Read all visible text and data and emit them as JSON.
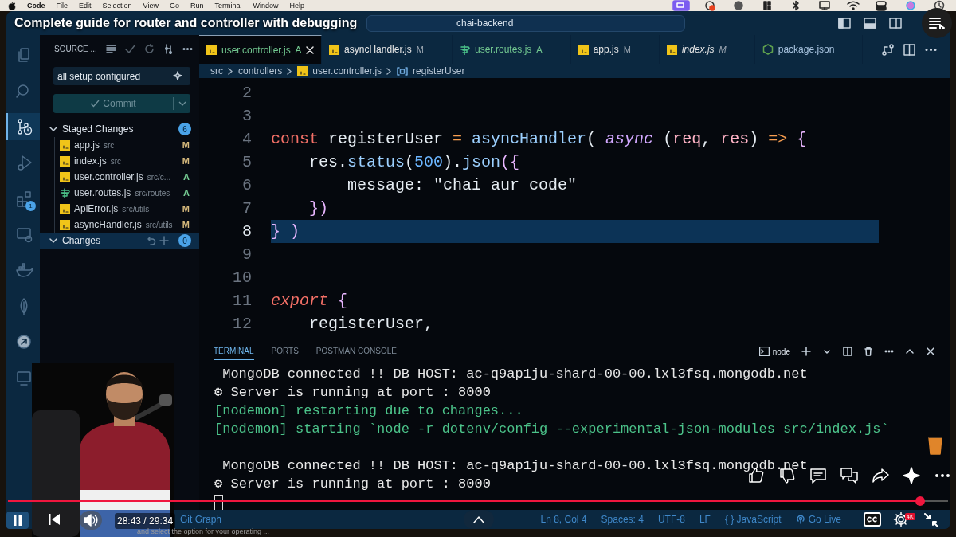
{
  "menubar": {
    "items": [
      "Code",
      "File",
      "Edit",
      "Selection",
      "View",
      "Go",
      "Run",
      "Terminal",
      "Window",
      "Help"
    ]
  },
  "video": {
    "title": "Complete guide for router and controller with debugging",
    "time": "28:43 / 29:34",
    "level": 0.97,
    "playing": true,
    "quality_badge": "4K"
  },
  "window": {
    "search": "chai-backend"
  },
  "activity_bar": {
    "items": [
      {
        "kind": "files",
        "selected": false
      },
      {
        "kind": "search",
        "selected": false
      },
      {
        "kind": "scm",
        "selected": true
      },
      {
        "kind": "debug",
        "selected": false
      },
      {
        "kind": "extensions",
        "selected": false,
        "badge": "1"
      },
      {
        "kind": "remote",
        "selected": false
      },
      {
        "kind": "docker",
        "selected": false
      },
      {
        "kind": "leaf",
        "selected": false
      },
      {
        "kind": "share",
        "selected": false
      },
      {
        "kind": "screen",
        "selected": false
      }
    ]
  },
  "sidebar": {
    "title": "SOURCE ...",
    "commit_message": "all setup configured",
    "commit_button": "Commit",
    "staged": {
      "label": "Staged Changes",
      "count": "6",
      "expanded": true,
      "files": [
        {
          "name": "app.js",
          "path": "src",
          "status": "M",
          "kind": "js",
          "color": "#d7ba7d"
        },
        {
          "name": "index.js",
          "path": "src",
          "status": "M",
          "kind": "js",
          "color": "#d7ba7d"
        },
        {
          "name": "user.controller.js",
          "path": "src/c...",
          "status": "A",
          "kind": "js",
          "color": "#73c991"
        },
        {
          "name": "user.routes.js",
          "path": "src/routes",
          "status": "A",
          "kind": "route",
          "color": "#73c991"
        },
        {
          "name": "ApiError.js",
          "path": "src/utils",
          "status": "M",
          "kind": "js",
          "color": "#d7ba7d"
        },
        {
          "name": "asyncHandler.js",
          "path": "src/utils",
          "status": "M",
          "kind": "js",
          "color": "#d7ba7d"
        }
      ]
    },
    "changes": {
      "label": "Changes",
      "count": "0",
      "expanded": true
    }
  },
  "tabs": [
    {
      "label": "user.controller.js",
      "status": "A",
      "kind": "js",
      "selected": true,
      "preview": false,
      "color": "#73c991"
    },
    {
      "label": "asyncHandler.js",
      "status": "M",
      "kind": "js",
      "selected": false,
      "preview": false,
      "color": "#e6e6e6"
    },
    {
      "label": "user.routes.js",
      "status": "A",
      "kind": "route",
      "selected": false,
      "preview": false,
      "color": "#73c991"
    },
    {
      "label": "app.js",
      "status": "M",
      "kind": "js",
      "selected": false,
      "preview": false,
      "color": "#e6e6e6"
    },
    {
      "label": "index.js",
      "status": "M",
      "kind": "js",
      "selected": false,
      "preview": true,
      "color": "#e6e6e6"
    },
    {
      "label": "package.json",
      "kind": "node",
      "selected": false,
      "preview": false,
      "color": "#a9c4e0"
    }
  ],
  "breadcrumb": [
    {
      "text": "src",
      "kind": "folder"
    },
    {
      "text": "controllers",
      "kind": "folder"
    },
    {
      "text": "user.controller.js",
      "kind": "js"
    },
    {
      "text": "registerUser",
      "kind": "symbol"
    }
  ],
  "code": [
    {
      "number": "2",
      "selected": false
    },
    {
      "number": "3",
      "selected": false
    },
    {
      "number": "4",
      "selected": false,
      "tokens": [
        {
          "text": "const ",
          "kind": "keyword"
        },
        {
          "text": "registerUser ",
          "kind": "plain"
        },
        {
          "text": "= ",
          "kind": "op"
        },
        {
          "text": "asyncHandler",
          "kind": "fn"
        },
        {
          "text": "( ",
          "kind": "punct"
        },
        {
          "text": "async ",
          "kind": "italic"
        },
        {
          "text": "(",
          "kind": "punct"
        },
        {
          "text": "req",
          "kind": "param"
        },
        {
          "text": ", ",
          "kind": "plain"
        },
        {
          "text": "res",
          "kind": "param"
        },
        {
          "text": ") ",
          "kind": "punct"
        },
        {
          "text": "=> ",
          "kind": "op"
        },
        {
          "text": "{",
          "kind": "brace"
        }
      ]
    },
    {
      "number": "5",
      "selected": false,
      "tokens": [
        {
          "text": "    res.",
          "kind": "plain"
        },
        {
          "text": "status",
          "kind": "fn"
        },
        {
          "text": "(",
          "kind": "punct"
        },
        {
          "text": "500",
          "kind": "number"
        },
        {
          "text": ").",
          "kind": "punct"
        },
        {
          "text": "json",
          "kind": "fn"
        },
        {
          "text": "({",
          "kind": "brace"
        }
      ]
    },
    {
      "number": "6",
      "selected": false,
      "tokens": [
        {
          "text": "        message: ",
          "kind": "plain"
        },
        {
          "text": "\"chai aur code\"",
          "kind": "string"
        }
      ]
    },
    {
      "number": "7",
      "selected": false,
      "tokens": [
        {
          "text": "    })",
          "kind": "brace"
        }
      ]
    },
    {
      "number": "8",
      "selected": true,
      "tokens": [
        {
          "text": "} )",
          "kind": "brace"
        }
      ]
    },
    {
      "number": "9",
      "selected": false
    },
    {
      "number": "10",
      "selected": false
    },
    {
      "number": "11",
      "selected": false,
      "tokens": [
        {
          "text": "export ",
          "kind": "italic-keyword"
        },
        {
          "text": "{",
          "kind": "brace"
        }
      ]
    },
    {
      "number": "12",
      "selected": false,
      "tokens": [
        {
          "text": "    registerUser,",
          "kind": "plain"
        }
      ]
    }
  ],
  "panel": {
    "tabs": [
      {
        "label": "TERMINAL",
        "selected": true
      },
      {
        "label": "PORTS",
        "selected": false
      },
      {
        "label": "POSTMAN CONSOLE",
        "selected": false
      }
    ],
    "shell": "node",
    "lines": [
      {
        "kind": "plain",
        "text": " MongoDB connected !! DB HOST: ac-q9ap1ju-shard-00-00.lxl3fsq.mongodb.net"
      },
      {
        "kind": "plain",
        "text": "⚙ Server is running at port : 8000"
      },
      {
        "kind": "nodemon",
        "text": "[nodemon] restarting due to changes..."
      },
      {
        "kind": "nodemon",
        "text": "[nodemon] starting `node -r dotenv/config --experimental-json-modules src/index.js`"
      },
      {
        "kind": "spacer"
      },
      {
        "kind": "plain",
        "text": " MongoDB connected !! DB HOST: ac-q9ap1ju-shard-00-00.lxl3fsq.mongodb.net"
      },
      {
        "kind": "plain",
        "text": "⚙ Server is running at port : 8000"
      }
    ]
  },
  "status_bar": {
    "left": "Git Graph",
    "right": [
      {
        "kind": "text",
        "text": "Ln 8, Col 4"
      },
      {
        "kind": "text",
        "text": "Spaces: 4"
      },
      {
        "kind": "text",
        "text": "UTF-8"
      },
      {
        "kind": "text",
        "text": "LF"
      },
      {
        "kind": "text",
        "text": "{ } JavaScript"
      },
      {
        "kind": "live",
        "text": "Go Live"
      }
    ]
  },
  "notification_fragment": "and select the option for your operating ..."
}
